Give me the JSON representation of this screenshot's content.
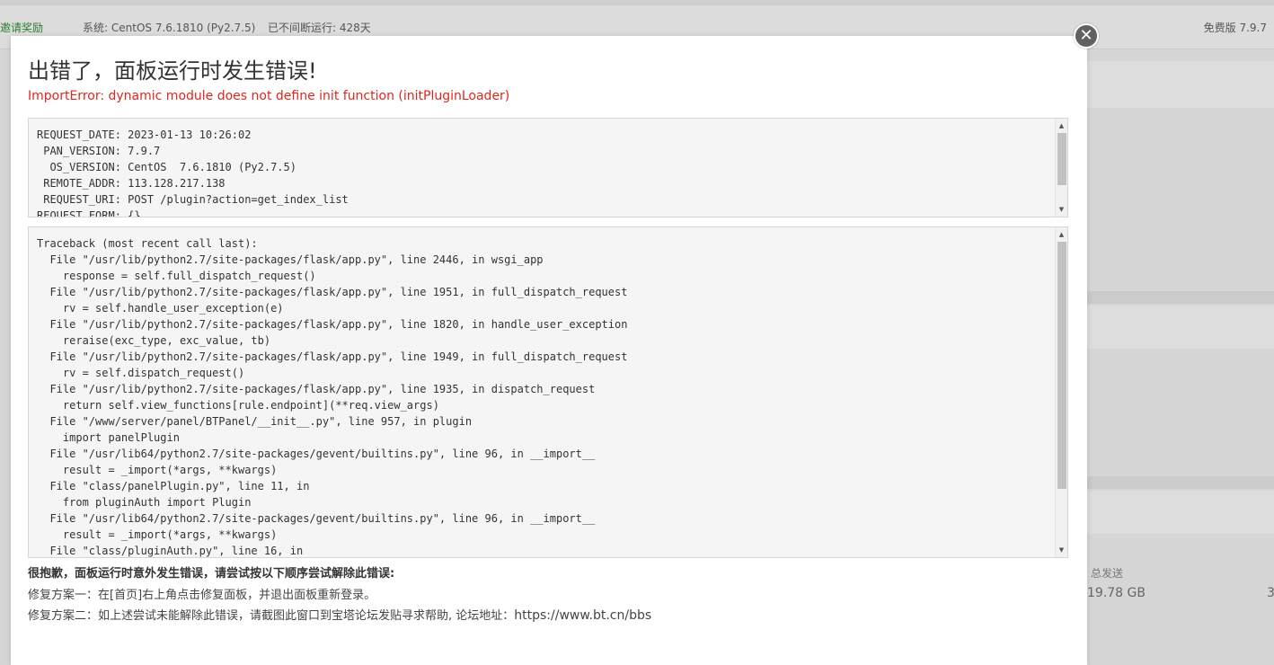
{
  "background": {
    "invite": "邀请奖励",
    "system_label": "系统:",
    "system_value": "CentOS 7.6.1810 (Py2.7.5)",
    "uptime": "已不间断运行: 428天",
    "edition_label": "免费版",
    "edition_version": "7.9.7",
    "total_send_label": "总发送",
    "total_send_value": "19.78 GB",
    "total_send_extra": "3"
  },
  "dialog": {
    "title": "出错了，面板运行时发生错误!",
    "error_message": "ImportError: dynamic module does not define init function (initPluginLoader)",
    "request_info": "REQUEST_DATE: 2023-01-13 10:26:02\n PAN_VERSION: 7.9.7\n  OS_VERSION: CentOS  7.6.1810 (Py2.7.5)\n REMOTE_ADDR: 113.128.217.138\n REQUEST_URI: POST /plugin?action=get_index_list\nREQUEST_FORM: {}",
    "traceback": "Traceback (most recent call last):\n  File \"/usr/lib/python2.7/site-packages/flask/app.py\", line 2446, in wsgi_app\n    response = self.full_dispatch_request()\n  File \"/usr/lib/python2.7/site-packages/flask/app.py\", line 1951, in full_dispatch_request\n    rv = self.handle_user_exception(e)\n  File \"/usr/lib/python2.7/site-packages/flask/app.py\", line 1820, in handle_user_exception\n    reraise(exc_type, exc_value, tb)\n  File \"/usr/lib/python2.7/site-packages/flask/app.py\", line 1949, in full_dispatch_request\n    rv = self.dispatch_request()\n  File \"/usr/lib/python2.7/site-packages/flask/app.py\", line 1935, in dispatch_request\n    return self.view_functions[rule.endpoint](**req.view_args)\n  File \"/www/server/panel/BTPanel/__init__.py\", line 957, in plugin\n    import panelPlugin\n  File \"/usr/lib64/python2.7/site-packages/gevent/builtins.py\", line 96, in __import__\n    result = _import(*args, **kwargs)\n  File \"class/panelPlugin.py\", line 11, in\n    from pluginAuth import Plugin\n  File \"/usr/lib64/python2.7/site-packages/gevent/builtins.py\", line 96, in __import__\n    result = _import(*args, **kwargs)\n  File \"class/pluginAuth.py\", line 16, in",
    "fix_title": "很抱歉，面板运行时意外发生错误，请尝试按以下顺序尝试解除此错误:",
    "fix_1": "修复方案一：在[首页]右上角点击修复面板，并退出面板重新登录。",
    "fix_2_text": "修复方案二：如上述尝试未能解除此错误，请截图此窗口到宝塔论坛发贴寻求帮助, 论坛地址：",
    "fix_2_url": "https://www.bt.cn/bbs",
    "close_icon": "close-icon"
  }
}
